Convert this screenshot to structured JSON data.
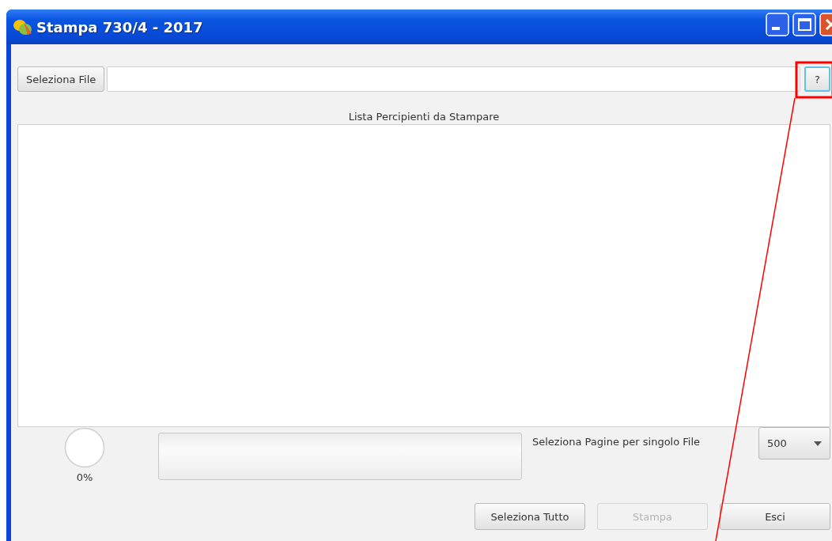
{
  "window": {
    "title": "Stampa 730/4 - 2017"
  },
  "file_row": {
    "button": "Seleziona File",
    "help_button": {
      "label": "?",
      "highlighted": true
    }
  },
  "list": {
    "title": "Lista Percipienti da Stampare"
  },
  "spinner": {
    "reading": "0%"
  },
  "progress_bar": {
    "level": 0
  },
  "pages_per_file": {
    "label": "Seleziona Pagine per singolo File",
    "value": "500"
  },
  "buttons": [
    {
      "label": "Seleziona Tutto",
      "disabled": false
    },
    {
      "label": "Stampa",
      "disabled": true
    },
    {
      "label": "Esci",
      "disabled": false
    }
  ]
}
